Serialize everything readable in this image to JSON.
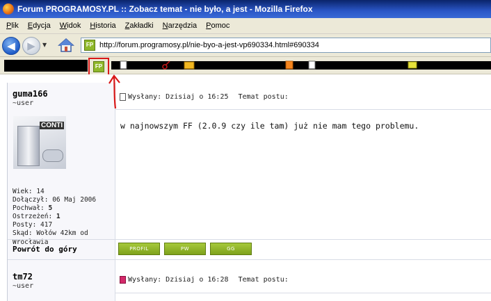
{
  "window": {
    "title": "Forum PROGRAMOSY.PL :: Zobacz temat - nie było, a jest - Mozilla Firefox"
  },
  "menubar": {
    "items": [
      "Plik",
      "Edycja",
      "Widok",
      "Historia",
      "Zakładki",
      "Narzędzia",
      "Pomoc"
    ]
  },
  "navbar": {
    "url": "http://forum.programosy.pl/nie-byo-a-jest-vp690334.html#690334",
    "site_icon_text": "FP"
  },
  "bookmarks": {
    "highlighted_icon_text": "FP"
  },
  "posts": [
    {
      "username": "guma166",
      "rank": "~user",
      "avatar_label": "CONTI",
      "header_sent": "Wysłany: Dzisiaj o 16:25",
      "header_topic": "Temat postu:",
      "message": "w najnowszym FF (2.0.9 czy ile tam) już nie mam tego problemu.",
      "stats": {
        "age": "Wiek: 14",
        "joined": "Dołączył: 06 Maj 2006",
        "praise_label": "Pochwał: ",
        "praise_value": "5",
        "warnings_label": "Ostrzeżeń: ",
        "warnings_value": "1",
        "posts": "Posty: 417",
        "from": "Skąd: Wołów 42km od Wrocławia"
      },
      "back_to_top": "Powrót do góry",
      "buttons": [
        "PROFIL",
        "PW",
        "GG"
      ]
    },
    {
      "username": "tm72",
      "rank": "~user",
      "header_sent": "Wysłany: Dzisiaj o 16:28",
      "header_topic": "Temat postu:"
    }
  ]
}
